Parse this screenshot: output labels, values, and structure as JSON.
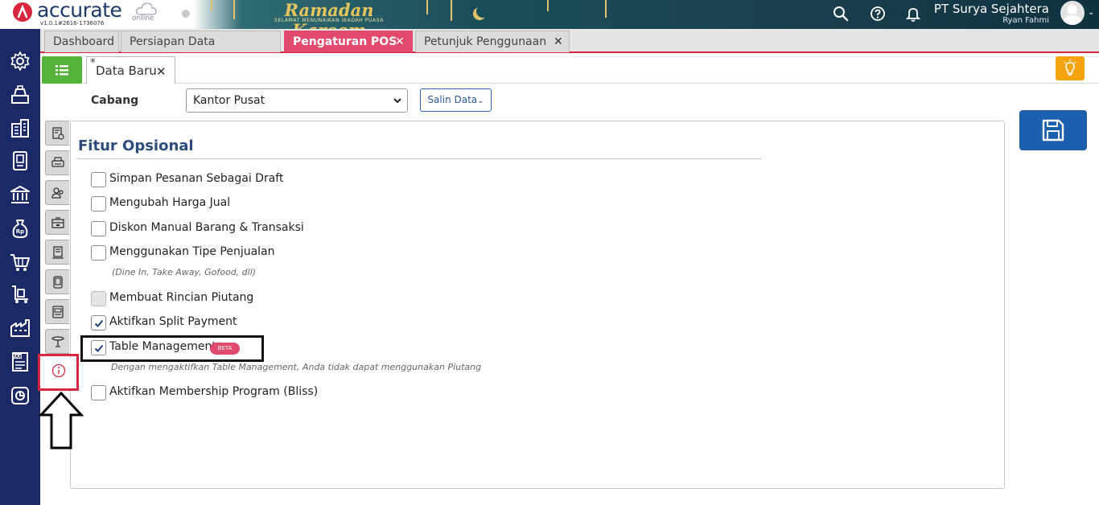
{
  "app": {
    "brand": "accurate",
    "edition": "online",
    "version": "v1.0.1#2616-1736076",
    "banner_title": "Ramadan Kareem",
    "banner_subtitle": "SELAMAT MENUNAIKAN IBADAH PUASA",
    "company": "PT Surya Sejahtera",
    "user": "Ryan Fahmi",
    "icons": [
      "search-icon",
      "help-icon",
      "bell-icon",
      "avatar-icon"
    ]
  },
  "sidebar": {
    "items": [
      "gear-icon",
      "cash-register-icon",
      "building-icon",
      "ledger-icon",
      "bank-icon",
      "money-bag-icon",
      "cart-icon",
      "trolley-icon",
      "factory-icon",
      "tax-icon",
      "report-icon"
    ]
  },
  "tabs": [
    {
      "label": "Dashboard",
      "active": false,
      "closable": false
    },
    {
      "label": "Persiapan Data Perusahaan",
      "active": false,
      "closable": false
    },
    {
      "label": "Pengaturan POS",
      "active": true,
      "closable": true
    },
    {
      "label": "Petunjuk Penggunaan",
      "active": false,
      "closable": true
    }
  ],
  "tab_count": "4",
  "subtab": {
    "modified_marker": "*",
    "label": "Data Baru"
  },
  "form": {
    "cabang_label": "Cabang",
    "cabang_value": "Kantor Pusat",
    "salin_label": "Salin Data"
  },
  "section": {
    "title": "Fitur Opsional",
    "options": [
      {
        "label": "Simpan Pesanan Sebagai Draft",
        "checked": false,
        "disabled": false
      },
      {
        "label": "Mengubah Harga Jual",
        "checked": false,
        "disabled": false
      },
      {
        "label": "Diskon Manual Barang & Transaksi",
        "checked": false,
        "disabled": false
      },
      {
        "label": "Menggunakan Tipe Penjualan",
        "checked": false,
        "disabled": false,
        "hint": "(Dine In, Take Away, Gofood, dll)"
      },
      {
        "label": "Membuat Rincian Piutang",
        "checked": false,
        "disabled": true
      },
      {
        "label": "Aktifkan Split Payment",
        "checked": true,
        "disabled": false
      },
      {
        "label": "Table Management",
        "checked": true,
        "disabled": false,
        "badge": "BETA",
        "hint": "Dengan mengaktifkan Table Management, Anda tidak dapat menggunakan Piutang"
      },
      {
        "label": "Aktifkan Membership Program (Bliss)",
        "checked": false,
        "disabled": false
      }
    ]
  },
  "vertical_tabs": [
    "receipt-settings-icon",
    "printer-icon",
    "users-icon",
    "cashier-icon",
    "document-icon",
    "device-icon",
    "card-reader-icon",
    "table-icon",
    "info-icon"
  ],
  "colors": {
    "brand_red": "#d7263d",
    "sidebar_navy": "#1b2a66",
    "active_tab": "#e14a6d",
    "menu_green": "#55b33b",
    "save_blue": "#1c5fae",
    "bulb_orange": "#f5a20f"
  }
}
